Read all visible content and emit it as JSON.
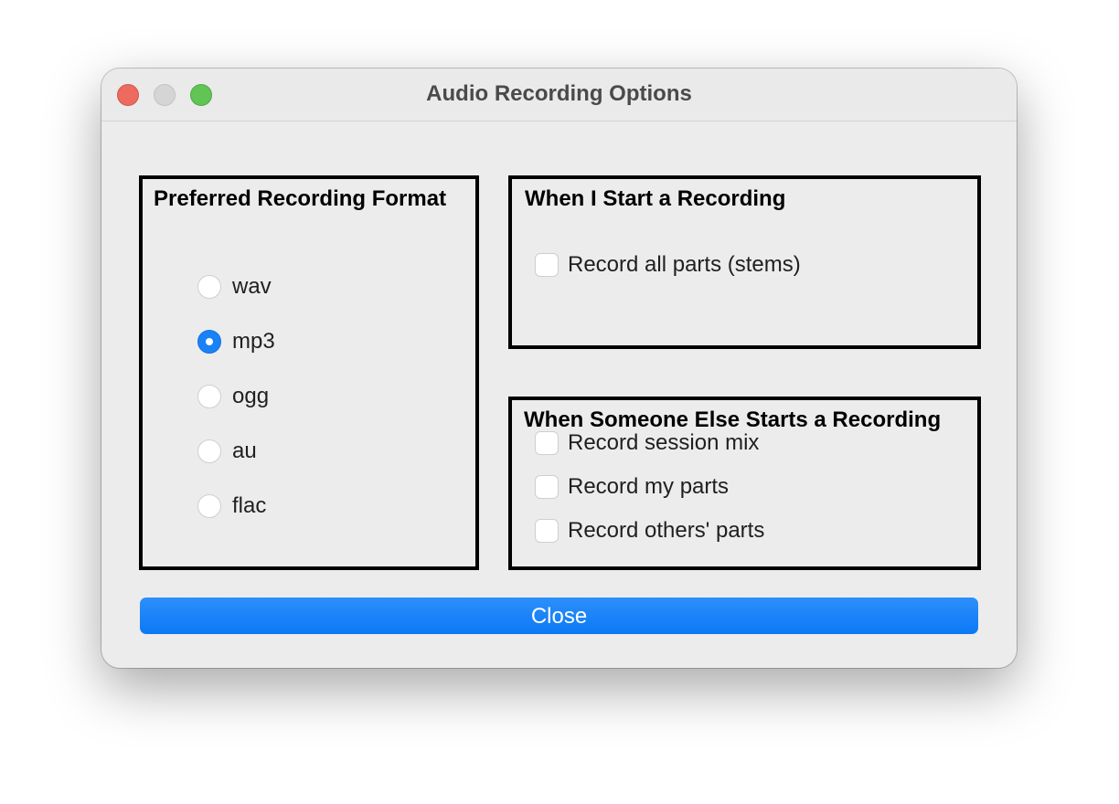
{
  "window": {
    "title": "Audio Recording Options"
  },
  "format_group": {
    "title": "Preferred Recording Format",
    "options": [
      {
        "label": "wav",
        "selected": false
      },
      {
        "label": "mp3",
        "selected": true
      },
      {
        "label": "ogg",
        "selected": false
      },
      {
        "label": "au",
        "selected": false
      },
      {
        "label": "flac",
        "selected": false
      }
    ]
  },
  "start_group": {
    "title": "When I Start a Recording",
    "options": [
      {
        "label": "Record all parts (stems)",
        "checked": false
      }
    ]
  },
  "else_group": {
    "title": "When Someone Else Starts a Recording",
    "options": [
      {
        "label": "Record session mix",
        "checked": false
      },
      {
        "label": "Record my parts",
        "checked": false
      },
      {
        "label": "Record others' parts",
        "checked": false
      }
    ]
  },
  "close_button": {
    "label": "Close"
  },
  "colors": {
    "accent": "#1a82f7",
    "close_light": "#ed6a5e",
    "minimize_light": "#d5d5d5",
    "zoom_light": "#61c454"
  }
}
